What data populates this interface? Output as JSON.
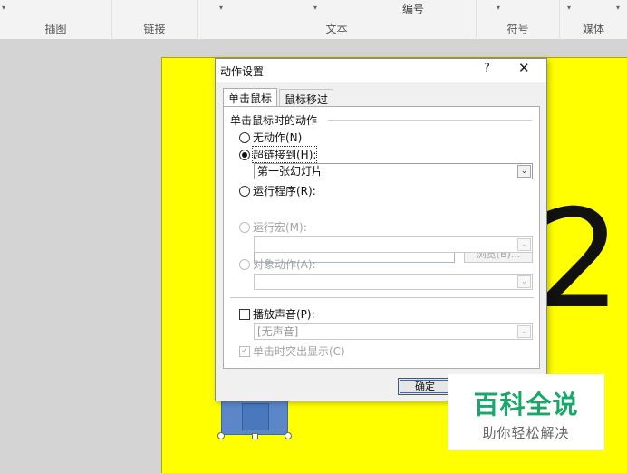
{
  "ribbon": {
    "groups": {
      "insert_image": "插图",
      "link": "链接",
      "text": "文本",
      "numbering": "编号",
      "symbol": "符号",
      "media": "媒体"
    }
  },
  "slide": {
    "big_number": "2"
  },
  "dialog": {
    "title": "动作设置",
    "help": "?",
    "close": "✕",
    "tabs": [
      "单击鼠标",
      "鼠标移过"
    ],
    "section": "单击鼠标时的动作",
    "options": {
      "none": "无动作(N)",
      "hyperlink": "超链接到(H):",
      "hyperlink_value": "第一张幻灯片",
      "run_program": "运行程序(R):",
      "browse": "浏览(B)...",
      "run_macro": "运行宏(M):",
      "object_action": "对象动作(A):"
    },
    "sound": {
      "label": "播放声音(P):",
      "value": "[无声音]"
    },
    "highlight": "单击时突出显示(C)",
    "ok": "确定"
  },
  "watermark": {
    "title": "百科全说",
    "subtitle": "助你轻松解决"
  }
}
